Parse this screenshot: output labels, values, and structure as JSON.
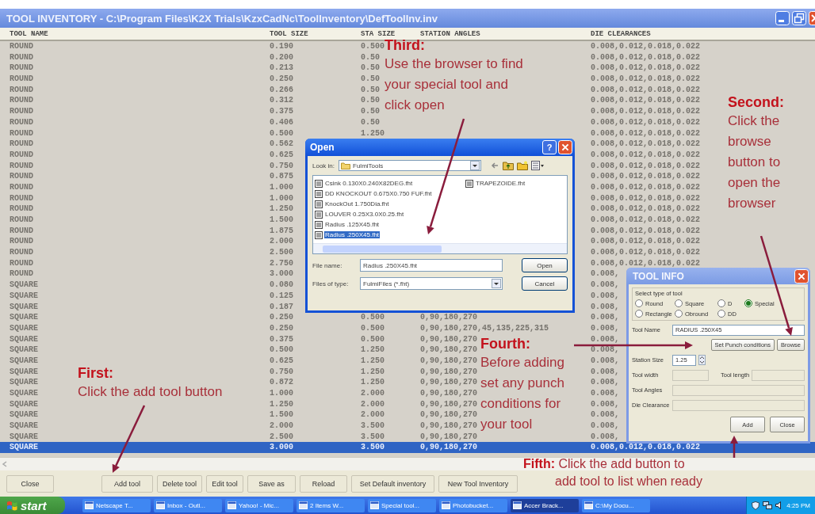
{
  "window": {
    "title": "TOOL INVENTORY - C:\\Program Files\\K2X Trials\\KzxCadNc\\ToolInventory\\DefToolInv.inv"
  },
  "table": {
    "columns": [
      "TOOL NAME",
      "TOOL SIZE",
      "STA SIZE",
      "STATION ANGLES",
      "DIE CLEARANCES"
    ],
    "rows": [
      {
        "tool_name": "ROUND",
        "tool_size": "0.190",
        "sta_size": "0.500",
        "die_clearances": "0.008,0.012,0.018,0.022",
        "selected": false
      },
      {
        "tool_name": "ROUND",
        "tool_size": "0.200",
        "sta_size": "0.50",
        "die_clearances": "0.008,0.012,0.018,0.022",
        "selected": false
      },
      {
        "tool_name": "ROUND",
        "tool_size": "0.213",
        "sta_size": "0.50",
        "die_clearances": "0.008,0.012,0.018,0.022",
        "selected": false
      },
      {
        "tool_name": "ROUND",
        "tool_size": "0.250",
        "sta_size": "0.50",
        "die_clearances": "0.008,0.012,0.018,0.022",
        "selected": false
      },
      {
        "tool_name": "ROUND",
        "tool_size": "0.266",
        "sta_size": "0.50",
        "die_clearances": "0.008,0.012,0.018,0.022",
        "selected": false
      },
      {
        "tool_name": "ROUND",
        "tool_size": "0.312",
        "sta_size": "0.50",
        "die_clearances": "0.008,0.012,0.018,0.022",
        "selected": false
      },
      {
        "tool_name": "ROUND",
        "tool_size": "0.375",
        "sta_size": "0.50",
        "die_clearances": "0.008,0.012,0.018,0.022",
        "selected": false
      },
      {
        "tool_name": "ROUND",
        "tool_size": "0.406",
        "sta_size": "0.50",
        "die_clearances": "0.008,0.012,0.018,0.022",
        "selected": false
      },
      {
        "tool_name": "ROUND",
        "tool_size": "0.500",
        "sta_size": "1.250",
        "die_clearances": "0.008,0.012,0.018,0.022",
        "selected": false
      },
      {
        "tool_name": "ROUND",
        "tool_size": "0.562",
        "die_clearances": "0.008,0.012,0.018,0.022",
        "selected": false
      },
      {
        "tool_name": "ROUND",
        "tool_size": "0.625",
        "die_clearances": "0.008,0.012,0.018,0.022",
        "selected": false
      },
      {
        "tool_name": "ROUND",
        "tool_size": "0.750",
        "die_clearances": "0.008,0.012,0.018,0.022",
        "selected": false
      },
      {
        "tool_name": "ROUND",
        "tool_size": "0.875",
        "die_clearances": "0.008,0.012,0.018,0.022",
        "selected": false
      },
      {
        "tool_name": "ROUND",
        "tool_size": "1.000",
        "die_clearances": "0.008,0.012,0.018,0.022",
        "selected": false
      },
      {
        "tool_name": "ROUND",
        "tool_size": "1.000",
        "die_clearances": "0.008,0.012,0.018,0.022",
        "selected": false
      },
      {
        "tool_name": "ROUND",
        "tool_size": "1.250",
        "die_clearances": "0.008,0.012,0.018,0.022",
        "selected": false
      },
      {
        "tool_name": "ROUND",
        "tool_size": "1.500",
        "die_clearances": "0.008,0.012,0.018,0.022",
        "selected": false
      },
      {
        "tool_name": "ROUND",
        "tool_size": "1.875",
        "die_clearances": "0.008,0.012,0.018,0.022",
        "selected": false
      },
      {
        "tool_name": "ROUND",
        "tool_size": "2.000",
        "die_clearances": "0.008,0.012,0.018,0.022",
        "selected": false
      },
      {
        "tool_name": "ROUND",
        "tool_size": "2.500",
        "die_clearances": "0.008,0.012,0.018,0.022",
        "selected": false
      },
      {
        "tool_name": "ROUND",
        "tool_size": "2.750",
        "die_clearances": "0.008,0.012,0.018,0.022",
        "selected": false
      },
      {
        "tool_name": "ROUND",
        "tool_size": "3.000",
        "die_clearances": "0.008,",
        "selected": false
      },
      {
        "tool_name": "SQUARE",
        "tool_size": "0.080",
        "die_clearances": "0.008,",
        "selected": false
      },
      {
        "tool_name": "SQUARE",
        "tool_size": "0.125",
        "die_clearances": "0.008,",
        "selected": false
      },
      {
        "tool_name": "SQUARE",
        "tool_size": "0.187",
        "die_clearances": "0.008,",
        "selected": false
      },
      {
        "tool_name": "SQUARE",
        "tool_size": "0.250",
        "sta_size": "0.500",
        "station_angles": "0,90,180,270",
        "die_clearances": "0.008,",
        "selected": false
      },
      {
        "tool_name": "SQUARE",
        "tool_size": "0.250",
        "sta_size": "0.500",
        "station_angles": "0,90,180,270,45,135,225,315",
        "die_clearances": "0.008,",
        "selected": false
      },
      {
        "tool_name": "SQUARE",
        "tool_size": "0.375",
        "sta_size": "0.500",
        "station_angles": "0,90,180,270",
        "die_clearances": "0.008,",
        "selected": false
      },
      {
        "tool_name": "SQUARE",
        "tool_size": "0.500",
        "sta_size": "1.250",
        "station_angles": "0,90,180,270",
        "die_clearances": "0.008,",
        "selected": false
      },
      {
        "tool_name": "SQUARE",
        "tool_size": "0.625",
        "sta_size": "1.250",
        "station_angles": "0,90,180,270",
        "die_clearances": "0.008,",
        "selected": false
      },
      {
        "tool_name": "SQUARE",
        "tool_size": "0.750",
        "sta_size": "1.250",
        "station_angles": "0,90,180,270",
        "die_clearances": "0.008,",
        "selected": false
      },
      {
        "tool_name": "SQUARE",
        "tool_size": "0.872",
        "sta_size": "1.250",
        "station_angles": "0,90,180,270",
        "die_clearances": "0.008,",
        "selected": false
      },
      {
        "tool_name": "SQUARE",
        "tool_size": "1.000",
        "sta_size": "2.000",
        "station_angles": "0,90,180,270",
        "die_clearances": "0.008,",
        "selected": false
      },
      {
        "tool_name": "SQUARE",
        "tool_size": "1.250",
        "sta_size": "2.000",
        "station_angles": "0,90,180,270",
        "die_clearances": "0.008,",
        "selected": false
      },
      {
        "tool_name": "SQUARE",
        "tool_size": "1.500",
        "sta_size": "2.000",
        "station_angles": "0,90,180,270",
        "die_clearances": "0.008,",
        "selected": false
      },
      {
        "tool_name": "SQUARE",
        "tool_size": "2.000",
        "sta_size": "3.500",
        "station_angles": "0,90,180,270",
        "die_clearances": "0.008,",
        "selected": false
      },
      {
        "tool_name": "SQUARE",
        "tool_size": "2.500",
        "sta_size": "3.500",
        "station_angles": "0,90,180,270",
        "die_clearances": "0.008,",
        "selected": false
      },
      {
        "tool_name": "SQUARE",
        "tool_size": "3.000",
        "sta_size": "3.500",
        "station_angles": "0,90,180,270",
        "die_clearances": "0.008,0.012,0.018,0.022",
        "selected": true
      }
    ]
  },
  "buttons": [
    "Close",
    "Add tool",
    "Delete tool",
    "Edit tool",
    "Save as",
    "Reload",
    "Set Default inventory",
    "New Tool Inventory"
  ],
  "open_dialog": {
    "title": "Open",
    "help_button": "?",
    "look_in_label": "Look in:",
    "look_in": "FulmiTools",
    "files": [
      {
        "name": "Csink 0.130X0.240X82DEG.fht",
        "selected": false
      },
      {
        "name": "DD KNOCKOUT 0.675X0.750 FUF.fht",
        "selected": false
      },
      {
        "name": "KnockOut 1.750Dia.fht",
        "selected": false
      },
      {
        "name": "LOUVER 0.25X3.0X0.25.fht",
        "selected": false
      },
      {
        "name": "Radius .125X45.fht",
        "selected": false
      },
      {
        "name": "Radius .250X45.fht",
        "selected": true
      },
      {
        "name": "TRAPEZOIDE.fht",
        "selected": false
      }
    ],
    "file_name_label": "File name:",
    "file_name": "Radius .250X45.fht",
    "file_type_label": "Files of type:",
    "file_type": "FulmiFiles (*.fht)",
    "buttons": [
      "Open",
      "Cancel"
    ]
  },
  "tool_info": {
    "title": "TOOL INFO",
    "group_label": "Select type of tool",
    "tool_types": [
      {
        "label": "Round",
        "selected": false
      },
      {
        "label": "Square",
        "selected": false
      },
      {
        "label": "D",
        "selected": false
      },
      {
        "label": "Special",
        "selected": true
      },
      {
        "label": "Rectangle",
        "selected": false
      },
      {
        "label": "Obround",
        "selected": false
      },
      {
        "label": "DD",
        "selected": false
      }
    ],
    "fields": [
      {
        "label": "Tool Name",
        "value": "RADIUS .250X45",
        "disabled": false
      },
      {
        "label": "Station Size",
        "value": "1.25",
        "disabled": false
      },
      {
        "label": "Tool width",
        "disabled": true
      },
      {
        "label": "Tool length",
        "disabled": true
      },
      {
        "label": "Tool Angles",
        "disabled": true
      },
      {
        "label": "Die Clearance",
        "disabled": true
      }
    ],
    "name_buttons": [
      "Set Punch conditions",
      "Browse"
    ],
    "buttons": [
      "Add",
      "Close"
    ]
  },
  "annotations": [
    {
      "kind": "stacked",
      "heading": "Third:",
      "text": "Use the browser to find\nyour special tool and\nclick open"
    },
    {
      "kind": "stacked",
      "heading": "Second:",
      "text": "Click the\nbrowse\nbutton to\nopen the\nbrowser"
    },
    {
      "kind": "stacked",
      "heading": "First:",
      "text": "Click the add tool button"
    },
    {
      "kind": "stacked",
      "heading": "Fourth:",
      "text": "Before adding\nset any punch\nconditions for\nyour tool"
    },
    {
      "kind": "inline",
      "text": "**Fifth:** Click the add button to\nadd tool to list when ready"
    }
  ],
  "taskbar": {
    "start": "start",
    "items": [
      {
        "label": "Netscape T...",
        "selected": false
      },
      {
        "label": "Inbox - Outl...",
        "selected": false
      },
      {
        "label": "Yahoo! - Mic...",
        "selected": false
      },
      {
        "label": "2 Items W...",
        "selected": false
      },
      {
        "label": "Special tool...",
        "selected": false
      },
      {
        "label": "Photobucket...",
        "selected": false
      },
      {
        "label": "Accer Brack...",
        "selected": true
      },
      {
        "label": "C:\\My Docu...",
        "selected": false
      }
    ],
    "clock": "4:25 PM"
  }
}
